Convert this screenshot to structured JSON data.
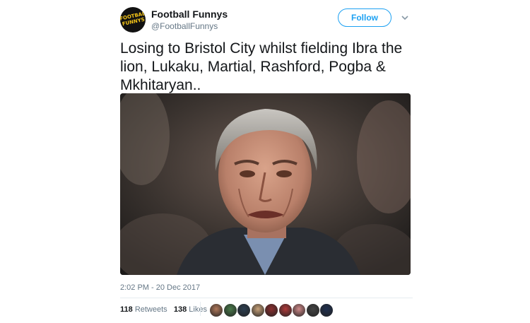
{
  "tweet": {
    "author_name": "Football Funnys",
    "handle": "@FootballFunnys",
    "avatar_text": "FOOTBALL FUNNYS",
    "follow_label": "Follow",
    "text": "Losing to Bristol City whilst fielding Ibra the lion, Lukaku, Martial, Rashford, Pogba & Mkhitaryan..",
    "timestamp": "2:02 PM - 20 Dec 2017",
    "retweets_count": "118",
    "retweets_label": "Retweets",
    "likes_count": "138",
    "likes_label": "Likes"
  },
  "icons": {
    "menu": "chevron-down-icon"
  },
  "colors": {
    "accent": "#1da1f2",
    "secondary_text": "#657786",
    "primary_text": "#14171a"
  },
  "liker_colors": [
    "#b0785a",
    "#4a7a4a",
    "#2c3e50",
    "#c8a27a",
    "#8b2e2e",
    "#b03a3a",
    "#d08a8a",
    "#444444",
    "#1f2f4f"
  ]
}
